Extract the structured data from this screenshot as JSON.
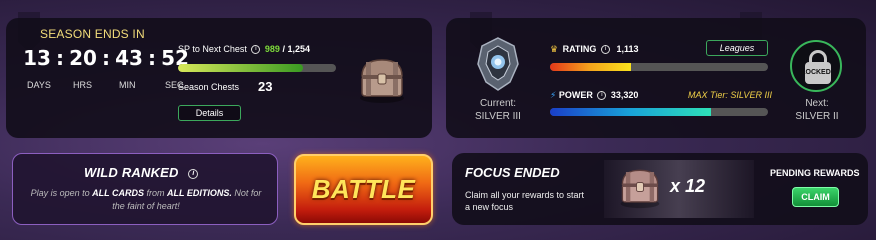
{
  "season": {
    "title": "SEASON ENDS IN",
    "timer": {
      "days": "13",
      "hours": "20",
      "minutes": "43",
      "seconds": "52",
      "sep": ":"
    },
    "labels": {
      "days": "DAYS",
      "hours": "HRS",
      "minutes": "MIN",
      "seconds": "SEC"
    },
    "sp_label": "SP to Next Chest",
    "sp_current": "989",
    "sp_total": "/ 1,254",
    "sp_fraction": 0.79,
    "chests_label": "Season Chests",
    "chests_count": "23",
    "details_label": "Details"
  },
  "rank": {
    "current_label": "Current:",
    "current_league": "SILVER III",
    "rating_label": "RATING",
    "rating_value": "1,113",
    "rating_fraction": 0.37,
    "leagues_label": "Leagues",
    "power_label": "POWER",
    "power_value": "33,320",
    "power_fraction": 0.74,
    "max_tier": "MAX Tier: SILVER III",
    "locked_label": "LOCKED",
    "next_label": "Next:",
    "next_league": "SILVER II"
  },
  "wild": {
    "title": "WILD RANKED",
    "desc_1": "Play is open to ",
    "desc_2": "ALL CARDS",
    "desc_3": " from ",
    "desc_4": "ALL EDITIONS.",
    "desc_5": " Not for the faint of heart!"
  },
  "battle": {
    "label": "BATTLE"
  },
  "focus": {
    "title": "FOCUS ENDED",
    "desc": "Claim all your rewards to start a new focus",
    "chest_count": "x 12",
    "pending_label": "PENDING REWARDS",
    "claim_label": "CLAIM"
  },
  "icons": {
    "info": "i",
    "chest": "chest-icon",
    "emblem": "league-emblem-icon",
    "lock": "lock-icon",
    "rating": "crown-icon",
    "power": "lightning-icon"
  }
}
